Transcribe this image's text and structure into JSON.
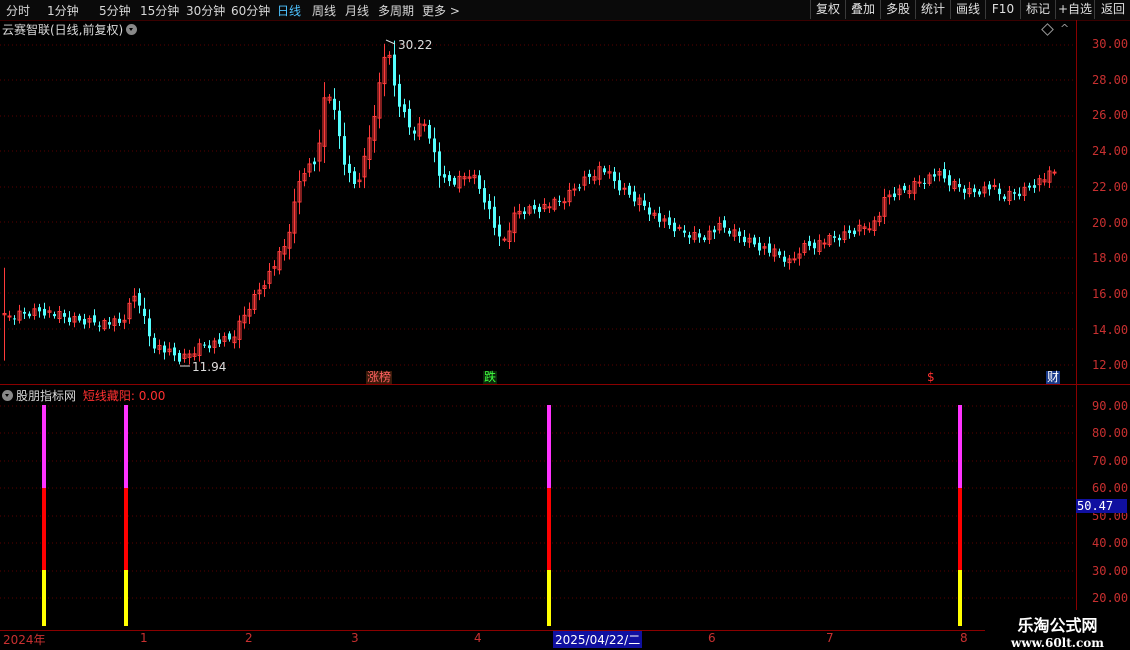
{
  "toolbar": {
    "periods": [
      "分时",
      "1分钟",
      "5分钟",
      "15分钟",
      "30分钟",
      "60分钟",
      "日线",
      "周线",
      "月线",
      "多周期",
      "更多 >"
    ],
    "active_period": "日线",
    "tools": [
      "复权",
      "叠加",
      "多股",
      "统计",
      "画线",
      "F10",
      "标记",
      "+自选",
      "返回"
    ]
  },
  "main_chart": {
    "title": "云赛智联(日线,前复权)",
    "high_marker": "30.22",
    "low_marker": "11.94",
    "price_ticks": [
      "30.00",
      "28.00",
      "26.00",
      "24.00",
      "22.00",
      "20.00",
      "18.00",
      "16.00",
      "14.00",
      "12.00"
    ],
    "events": [
      {
        "label": "涨榜",
        "color": "#ff6060",
        "bg": "#3a1a0a"
      },
      {
        "label": "跌",
        "color": "#40ff40",
        "bg": "#0a2a0a"
      },
      {
        "label": "$",
        "color": "#ff3030",
        "bg": "transparent"
      },
      {
        "label": "财",
        "color": "#ffffff",
        "bg": "#1a3a8a"
      }
    ]
  },
  "indicator": {
    "site_name": "股朋指标网",
    "formula_name": "短线藏阳: 0.00",
    "ticks": [
      "90.00",
      "80.00",
      "70.00",
      "60.00",
      "50.00",
      "40.00",
      "30.00",
      "20.00"
    ],
    "current_value": "50.47",
    "colors": {
      "top": "#ff33ff",
      "mid": "#ff0000",
      "bottom": "#ffff00"
    }
  },
  "date_axis": {
    "labels": [
      "2024年",
      "1",
      "2",
      "3",
      "4",
      "2025/04/22/二",
      "6",
      "7",
      "8"
    ]
  },
  "watermark": {
    "line1": "乐淘公式网",
    "line2": "www.60lt.com"
  },
  "colors": {
    "up": "#ff3b3b",
    "down": "#54ffff",
    "axis": "#8a0000",
    "grid": "#5a0000"
  }
}
